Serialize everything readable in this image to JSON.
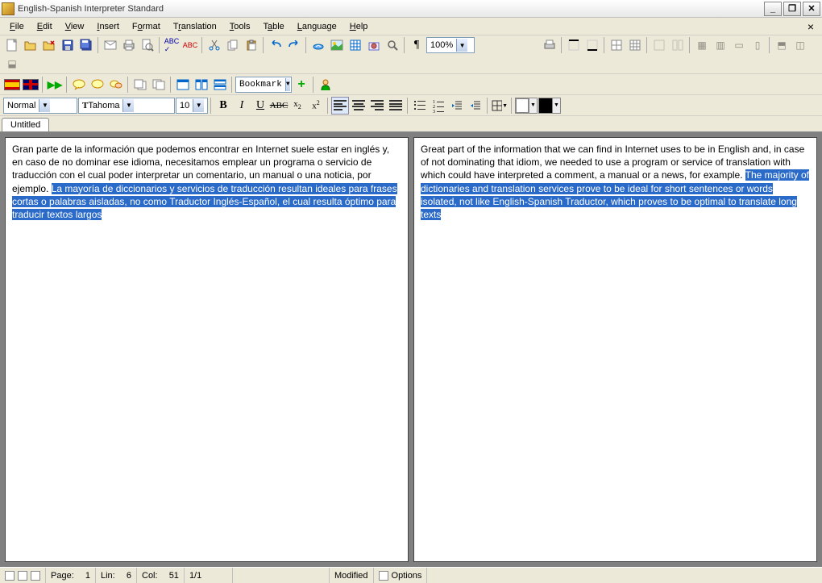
{
  "window": {
    "title": "English-Spanish Interpreter Standard"
  },
  "menu": {
    "file": "File",
    "edit": "Edit",
    "view": "View",
    "insert": "Insert",
    "format": "Format",
    "translation": "Translation",
    "tools": "Tools",
    "table": "Table",
    "language": "Language",
    "help": "Help"
  },
  "toolbar1": {
    "zoom": "100%"
  },
  "toolbar2": {
    "bookmark": "Bookmark"
  },
  "toolbar3": {
    "style": "Normal",
    "font": "Tahoma",
    "size": "10",
    "bold": "B",
    "italic": "I",
    "underline": "U",
    "strike": "ABC",
    "sub": "x",
    "sup": "x"
  },
  "colors": {
    "text_swatch": "#ffffff",
    "highlight_swatch": "#000000"
  },
  "tabs": {
    "untitled": "Untitled"
  },
  "panes": {
    "left": {
      "normal": "Gran parte de la información que podemos encontrar en Internet suele estar en inglés y, en caso de no dominar ese idioma, necesitamos emplear un programa o servicio de traducción con el cual poder interpretar un comentario, un manual o una noticia, por ejemplo. ",
      "selected": "La mayoría de diccionarios y servicios de traducción resultan ideales para frases cortas o palabras aisladas, no como Traductor Inglés-Español, el cual resulta óptimo para traducir textos largos"
    },
    "right": {
      "normal": "Great part of the information that we can find in Internet uses to be in English and, in case of not dominating that idiom, we needed to use a program or service of translation with which could have interpreted a comment, a manual or a news, for example. ",
      "selected": "The majority of dictionaries and translation services prove to be ideal for short sentences or words isolated, not like English-Spanish Traductor, which proves to be optimal to translate long texts"
    }
  },
  "status": {
    "page_label": "Page:",
    "page_value": "1",
    "lin_label": "Lin:",
    "lin_value": "6",
    "col_label": "Col:",
    "col_value": "51",
    "pages": "1/1",
    "modified": "Modified",
    "options": "Options"
  }
}
